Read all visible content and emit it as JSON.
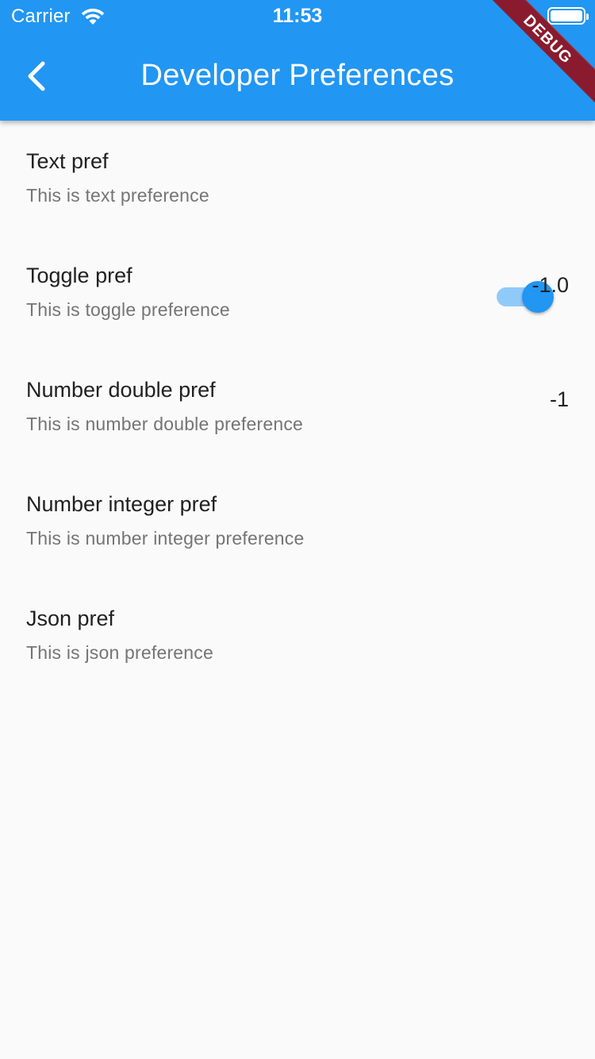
{
  "status_bar": {
    "carrier": "Carrier",
    "time": "11:53",
    "wifi_icon": "wifi-icon",
    "battery_icon": "battery-icon"
  },
  "app_bar": {
    "title": "Developer Preferences",
    "back_icon": "chevron-left-icon",
    "color": "#2196f3"
  },
  "debug_banner": "DEBUG",
  "preferences": [
    {
      "title": "Text pref",
      "subtitle": "This is text preference",
      "value": ""
    },
    {
      "title": "Toggle pref",
      "subtitle": "This is toggle preference",
      "toggle_on": true
    },
    {
      "title": "Number double pref",
      "subtitle": "This is number double preference",
      "value": "-1.0"
    },
    {
      "title": "Number integer pref",
      "subtitle": "This is number integer preference",
      "value": "-1"
    },
    {
      "title": "Json pref",
      "subtitle": "This is json preference",
      "value": ""
    }
  ]
}
